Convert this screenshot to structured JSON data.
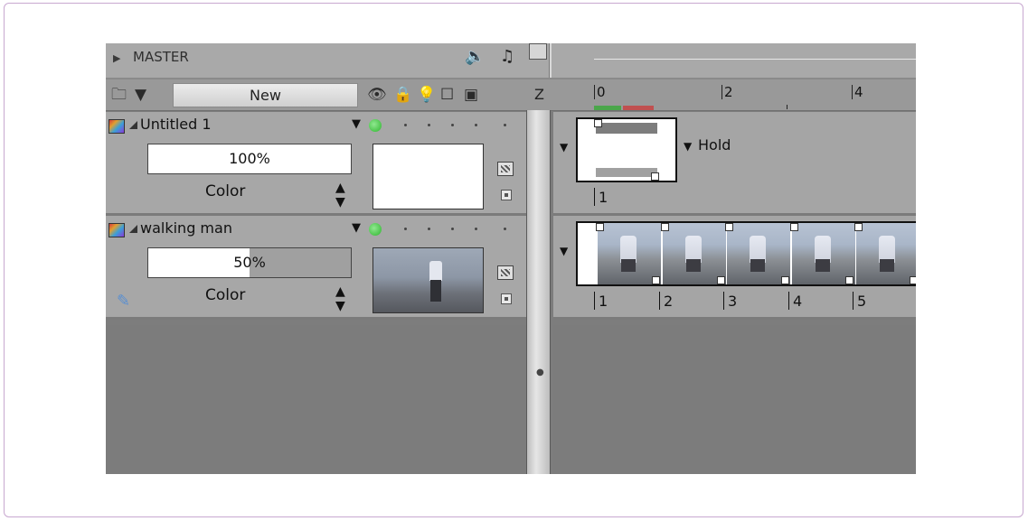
{
  "master": {
    "label": "MASTER"
  },
  "toolbar": {
    "new_label": "New",
    "z_label": "Z"
  },
  "ruler": {
    "ticks": [
      "0",
      "2",
      "4"
    ]
  },
  "layers": [
    {
      "name": "Untitled 1",
      "opacity": "100%",
      "opacity_value": 1.0,
      "blend": "Color",
      "visible": true
    },
    {
      "name": "walking man",
      "opacity": "50%",
      "opacity_value": 0.5,
      "blend": "Color",
      "visible": true
    }
  ],
  "timeline": {
    "row1": {
      "hold_label": "Hold",
      "frames": [
        "1"
      ]
    },
    "row2": {
      "frames": [
        "1",
        "2",
        "3",
        "4",
        "5"
      ]
    }
  },
  "colors": {
    "panel": "#a7a7a7",
    "empty": "#7c7c7c",
    "visible_dot": "#2fb52f",
    "play_green": "#4aa64a",
    "play_red": "#c05050"
  }
}
